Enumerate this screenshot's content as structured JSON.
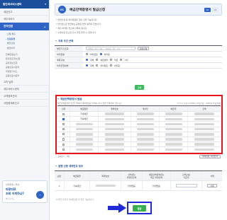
{
  "sidebar": {
    "header": "법인세서비스센터",
    "top_items": [
      "세금신고",
      "세무서비스"
    ],
    "active_section": "전자민원",
    "sub_items": [
      {
        "label": "· 신청/제출",
        "selected": false
      },
      {
        "label": "· 민원증명",
        "selected": true
      },
      {
        "label": "· 발급신청",
        "selected": false
      },
      {
        "label": "· 발급이력",
        "selected": false
      }
    ],
    "sub_items2": [
      "· 전체민원보기",
      "· 환급금조회/신청",
      "· 공유정보조회",
      "· 공동인증서관리",
      "· 국세청가이드",
      "· 공동인증서관리"
    ],
    "bottom_items": [
      "고지·납부",
      "세무서비스센터",
      "고객정보관리",
      "사업용계좌신고"
    ],
    "banner": {
      "line1": "타운웹게시 말상",
      "line2": "따로따로",
      "line3": "조회 어케하냐?",
      "more": "바로가기 ▸"
    }
  },
  "header": {
    "step_number": "01",
    "title": "예금잔액증명서 발급신청",
    "step_badges": [
      "01",
      "02"
    ]
  },
  "notes": [
    "* 발급신청 후 처리완료된 것만 출력 가능합니다.",
    "* 인터넷으로 발급하는 증명은 법적 효력이 있습니다.",
    "* 처리 이력은 전산에 기록이 됩니다.",
    "* 수정사항 있으면 다시 발급 받을 수 있습니다."
  ],
  "search_section": {
    "title": "조회 조건 선택",
    "rows": [
      {
        "label": "발급기간조회",
        "value": "2021 - 07 - 01  ~  2021 - 07 - 31",
        "button": "날짜선택"
      },
      {
        "label": "처리현황",
        "options": [
          "처리완료",
          "처리중"
        ],
        "selected": 1
      },
      {
        "label": "계좌구분",
        "options": [
          "전체",
          "예금계좌",
          "적금",
          "기타"
        ],
        "selected": 0
      },
      {
        "label": "처리진행여부",
        "options": [
          "전체",
          "처리완료",
          "처리중"
        ],
        "selected": 0
      }
    ],
    "lookup_button": "조회"
  },
  "results": {
    "title": "예금잔액증명서 발급",
    "description": "예금잔액증명서 발급을 위하여 계좌번호를 선택하시거나 직접 입력하여 주십시오.",
    "right_note": "총 1건 / 조회기간 2021년 07월 1일 ~ 2021년 07월 31일",
    "columns": [
      "선택",
      "예금종류",
      "계좌번호",
      "개설일",
      "예금주",
      "잔액"
    ],
    "rows": [
      {
        "checked": false,
        "type": "저축예금",
        "blurred": true
      },
      {
        "checked": true,
        "type": "저축예금",
        "blurred": true
      },
      {
        "checked": false,
        "type": "",
        "blurred": true
      },
      {
        "checked": false,
        "type": "",
        "blurred": true
      },
      {
        "checked": false,
        "type": "",
        "blurred": true
      },
      {
        "checked": false,
        "type": "",
        "blurred": true
      },
      {
        "checked": false,
        "type": "",
        "blurred": true
      },
      {
        "checked": false,
        "type": "",
        "blurred": true
      }
    ],
    "footer_left": "조회건수 : 8건",
    "footer_right": "계좌번호 직접입력"
  },
  "apply_section": {
    "title": "발행 신청 계좌번호 정보",
    "columns": [
      "순번",
      "예금종류",
      "계좌번호",
      "잔액(원)",
      "예금잔액금액(원)",
      "잔액구분",
      "삭제"
    ],
    "sub_columns": [
      "발행전잔액",
      "최근 발행잔액",
      "기준일"
    ],
    "row": {
      "no": "1",
      "type": "저축예금",
      "status1": "발행없음",
      "status2": "발행없음",
      "delete": "삭제"
    }
  },
  "footnote": "※ 발급 신청 후 처리완료된 후 발급 가능합니다.",
  "issue_button": "발급",
  "colors": {
    "primary": "#2f63c6",
    "highlight_red": "#e8141c",
    "highlight_blue": "#1f2bd8",
    "green": "#34b04f"
  }
}
